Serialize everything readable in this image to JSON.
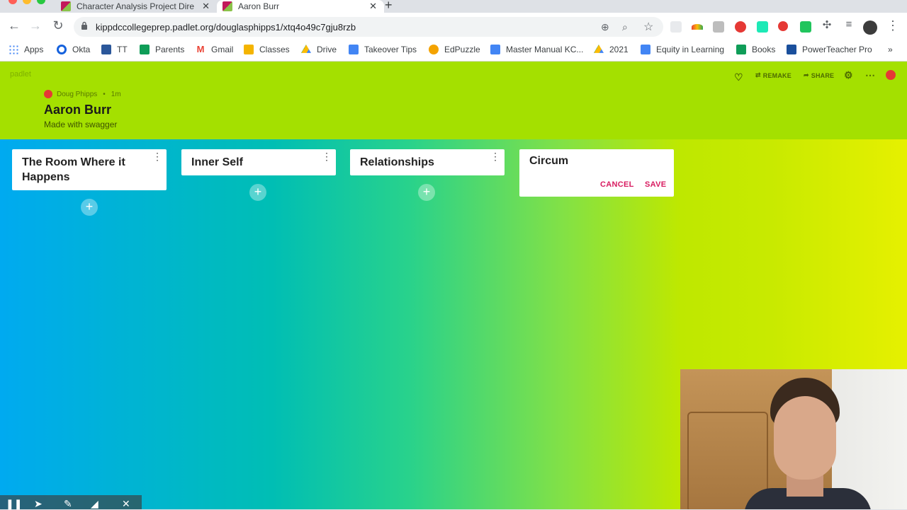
{
  "browser": {
    "tabs": [
      {
        "title": "Character Analysis Project Dire",
        "active": false
      },
      {
        "title": "Aaron Burr",
        "active": true
      }
    ],
    "url": "kippdccollegeprep.padlet.org/douglasphipps1/xtq4o49c7gju8rzb",
    "bookmarks": [
      {
        "label": "Apps",
        "icon": "apps-grid-icon",
        "color": "#4285f4"
      },
      {
        "label": "Okta",
        "icon": "okta-icon",
        "color": "#1662dd"
      },
      {
        "label": "TT",
        "icon": "word-icon",
        "color": "#2b579a"
      },
      {
        "label": "Parents",
        "icon": "sheets-icon",
        "color": "#0f9d58"
      },
      {
        "label": "Gmail",
        "icon": "gmail-icon",
        "color": "#ea4335"
      },
      {
        "label": "Classes",
        "icon": "classroom-icon",
        "color": "#f4b400"
      },
      {
        "label": "Drive",
        "icon": "drive-icon",
        "color": "#0f9d58"
      },
      {
        "label": "Takeover Tips",
        "icon": "docs-icon",
        "color": "#4285f4"
      },
      {
        "label": "EdPuzzle",
        "icon": "edpuzzle-icon",
        "color": "#f4a300"
      },
      {
        "label": "Master Manual KC...",
        "icon": "docs-icon",
        "color": "#4285f4"
      },
      {
        "label": "2021",
        "icon": "drive-icon",
        "color": "#0f9d58"
      },
      {
        "label": "Equity in Learning",
        "icon": "docs-icon",
        "color": "#4285f4"
      },
      {
        "label": "Books",
        "icon": "sheets-icon",
        "color": "#0f9d58"
      },
      {
        "label": "PowerTeacher Pro",
        "icon": "powerteacher-icon",
        "color": "#1a4f9c"
      }
    ],
    "more_bookmarks": "»"
  },
  "padlet": {
    "brand": "padlet",
    "author": "Doug Phipps",
    "time": "1m",
    "title": "Aaron Burr",
    "subtitle": "Made with swagger",
    "actions": {
      "remake": "REMAKE",
      "share": "SHARE"
    },
    "columns": [
      {
        "title": "The Room Where it Happens"
      },
      {
        "title": "Inner Self"
      },
      {
        "title": "Relationships"
      }
    ],
    "new_column": {
      "value": "Circum",
      "cancel": "CANCEL",
      "save": "SAVE"
    }
  },
  "colors": {
    "header_bg": "#a4e000",
    "accent_pink": "#d81b60"
  }
}
